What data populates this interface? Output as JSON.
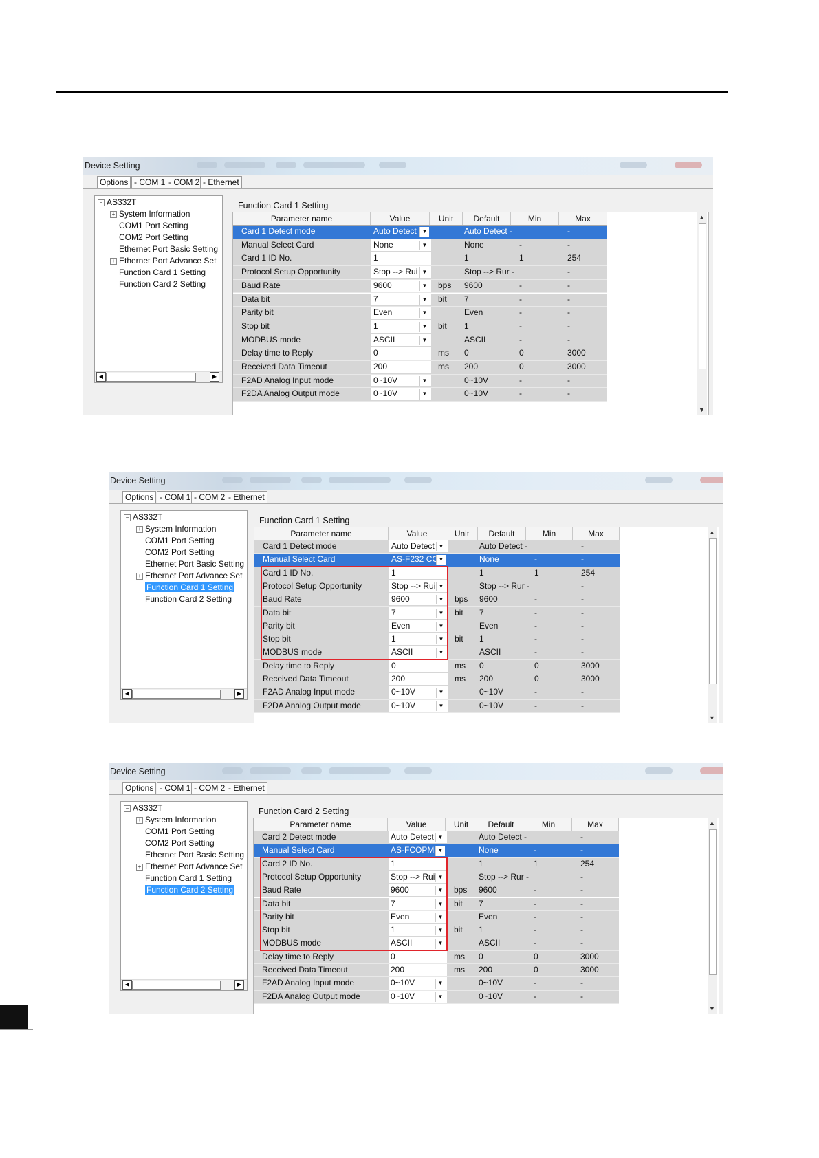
{
  "screenshots": [
    {
      "window_title": "Device Setting",
      "tabs": [
        "Options",
        "- COM 1",
        "- COM 2",
        "- Ethernet"
      ],
      "tree": [
        {
          "label": "AS332T",
          "expander": "−",
          "level": 0
        },
        {
          "label": "System Information",
          "expander": "+",
          "level": 1
        },
        {
          "label": "COM1 Port Setting",
          "expander": "",
          "level": 1
        },
        {
          "label": "COM2 Port Setting",
          "expander": "",
          "level": 1
        },
        {
          "label": "Ethernet Port Basic Setting",
          "expander": "",
          "level": 1
        },
        {
          "label": "Ethernet Port Advance Set",
          "expander": "+",
          "level": 1
        },
        {
          "label": "Function Card 1 Setting",
          "expander": "",
          "level": 1
        },
        {
          "label": "Function Card 2 Setting",
          "expander": "",
          "level": 1
        }
      ],
      "selected_tree_item": "",
      "panel_title": "Function Card 1 Setting",
      "columns": [
        "Parameter name",
        "Value",
        "Unit",
        "Default",
        "Min",
        "Max"
      ],
      "rows": [
        [
          "Card 1 Detect mode",
          "Auto Detect",
          "",
          "Auto Detect -",
          "",
          "-"
        ],
        [
          "Manual Select Card",
          "None",
          "",
          "None",
          "-",
          "-"
        ],
        [
          "Card 1 ID No.",
          "1",
          "",
          "1",
          "1",
          "254"
        ],
        [
          "Protocol Setup Opportunity",
          "Stop --> Rui",
          "",
          "Stop --> Rur -",
          "",
          "-"
        ],
        [
          "Baud Rate",
          "9600",
          "bps",
          "9600",
          "-",
          "-"
        ],
        [
          "Data bit",
          "7",
          "bit",
          "7",
          "-",
          "-"
        ],
        [
          "Parity bit",
          "Even",
          "",
          "Even",
          "-",
          "-"
        ],
        [
          "Stop bit",
          "1",
          "bit",
          "1",
          "-",
          "-"
        ],
        [
          "MODBUS mode",
          "ASCII",
          "",
          "ASCII",
          "-",
          "-"
        ],
        [
          "Delay time to Reply",
          "0",
          "ms",
          "0",
          "0",
          "3000"
        ],
        [
          "Received Data Timeout",
          "200",
          "ms",
          "200",
          "0",
          "3000"
        ],
        [
          "F2AD Analog Input mode",
          "0~10V",
          "",
          "0~10V",
          "-",
          "-"
        ],
        [
          "F2DA Analog Output mode",
          "0~10V",
          "",
          "0~10V",
          "-",
          "-"
        ]
      ]
    },
    {
      "window_title": "Device Setting",
      "tabs": [
        "Options",
        "- COM 1",
        "- COM 2",
        "- Ethernet"
      ],
      "tree": [
        {
          "label": "AS332T",
          "expander": "−",
          "level": 0
        },
        {
          "label": "System Information",
          "expander": "+",
          "level": 1
        },
        {
          "label": "COM1 Port Setting",
          "expander": "",
          "level": 1
        },
        {
          "label": "COM2 Port Setting",
          "expander": "",
          "level": 1
        },
        {
          "label": "Ethernet Port Basic Setting",
          "expander": "",
          "level": 1
        },
        {
          "label": "Ethernet Port Advance Set",
          "expander": "+",
          "level": 1
        },
        {
          "label": "Function Card 1 Setting",
          "expander": "",
          "level": 1
        },
        {
          "label": "Function Card 2 Setting",
          "expander": "",
          "level": 1
        }
      ],
      "selected_tree_item": "Function Card 1 Setting",
      "panel_title": "Function Card 1 Setting",
      "columns": [
        "Parameter name",
        "Value",
        "Unit",
        "Default",
        "Min",
        "Max"
      ],
      "rows": [
        [
          "Card 1 Detect mode",
          "Auto Detect",
          "",
          "Auto Detect -",
          "",
          "-"
        ],
        [
          "Manual Select Card",
          "AS-F232 CC",
          "",
          "None",
          "-",
          "-"
        ],
        [
          "Card 1 ID No.",
          "1",
          "",
          "1",
          "1",
          "254"
        ],
        [
          "Protocol Setup Opportunity",
          "Stop --> Rui",
          "",
          "Stop --> Rur -",
          "",
          "-"
        ],
        [
          "Baud Rate",
          "9600",
          "bps",
          "9600",
          "-",
          "-"
        ],
        [
          "Data bit",
          "7",
          "bit",
          "7",
          "-",
          "-"
        ],
        [
          "Parity bit",
          "Even",
          "",
          "Even",
          "-",
          "-"
        ],
        [
          "Stop bit",
          "1",
          "bit",
          "1",
          "-",
          "-"
        ],
        [
          "MODBUS mode",
          "ASCII",
          "",
          "ASCII",
          "-",
          "-"
        ],
        [
          "Delay time to Reply",
          "0",
          "ms",
          "0",
          "0",
          "3000"
        ],
        [
          "Received Data Timeout",
          "200",
          "ms",
          "200",
          "0",
          "3000"
        ],
        [
          "F2AD Analog Input mode",
          "0~10V",
          "",
          "0~10V",
          "-",
          "-"
        ],
        [
          "F2DA Analog Output mode",
          "0~10V",
          "",
          "0~10V",
          "-",
          "-"
        ]
      ]
    },
    {
      "window_title": "Device Setting",
      "tabs": [
        "Options",
        "- COM 1",
        "- COM 2",
        "- Ethernet"
      ],
      "tree": [
        {
          "label": "AS332T",
          "expander": "−",
          "level": 0
        },
        {
          "label": "System Information",
          "expander": "+",
          "level": 1
        },
        {
          "label": "COM1 Port Setting",
          "expander": "",
          "level": 1
        },
        {
          "label": "COM2 Port Setting",
          "expander": "",
          "level": 1
        },
        {
          "label": "Ethernet Port Basic Setting",
          "expander": "",
          "level": 1
        },
        {
          "label": "Ethernet Port Advance Set",
          "expander": "+",
          "level": 1
        },
        {
          "label": "Function Card 1 Setting",
          "expander": "",
          "level": 1
        },
        {
          "label": "Function Card 2 Setting",
          "expander": "",
          "level": 1
        }
      ],
      "selected_tree_item": "Function Card 2 Setting",
      "panel_title": "Function Card 2 Setting",
      "columns": [
        "Parameter name",
        "Value",
        "Unit",
        "Default",
        "Min",
        "Max"
      ],
      "rows": [
        [
          "Card 2 Detect mode",
          "Auto Detect",
          "",
          "Auto Detect -",
          "",
          "-"
        ],
        [
          "Manual Select Card",
          "AS-FCOPM",
          "",
          "None",
          "-",
          "-"
        ],
        [
          "Card 2 ID No.",
          "1",
          "",
          "1",
          "1",
          "254"
        ],
        [
          "Protocol Setup Opportunity",
          "Stop --> Rui",
          "",
          "Stop --> Rur -",
          "",
          "-"
        ],
        [
          "Baud Rate",
          "9600",
          "bps",
          "9600",
          "-",
          "-"
        ],
        [
          "Data bit",
          "7",
          "bit",
          "7",
          "-",
          "-"
        ],
        [
          "Parity bit",
          "Even",
          "",
          "Even",
          "-",
          "-"
        ],
        [
          "Stop bit",
          "1",
          "bit",
          "1",
          "-",
          "-"
        ],
        [
          "MODBUS mode",
          "ASCII",
          "",
          "ASCII",
          "-",
          "-"
        ],
        [
          "Delay time to Reply",
          "0",
          "ms",
          "0",
          "0",
          "3000"
        ],
        [
          "Received Data Timeout",
          "200",
          "ms",
          "200",
          "0",
          "3000"
        ],
        [
          "F2AD Analog Input mode",
          "0~10V",
          "",
          "0~10V",
          "-",
          "-"
        ],
        [
          "F2DA Analog Output mode",
          "0~10V",
          "",
          "0~10V",
          "-",
          "-"
        ]
      ]
    }
  ],
  "icons": {
    "dropdown": "▼",
    "scroll_up": "▲",
    "scroll_down": "▼",
    "scroll_left": "◀",
    "scroll_right": "▶"
  },
  "colors": {
    "selection": "#3378d6",
    "highlight_box": "#e0242b",
    "tree_selection": "#3399ff"
  }
}
